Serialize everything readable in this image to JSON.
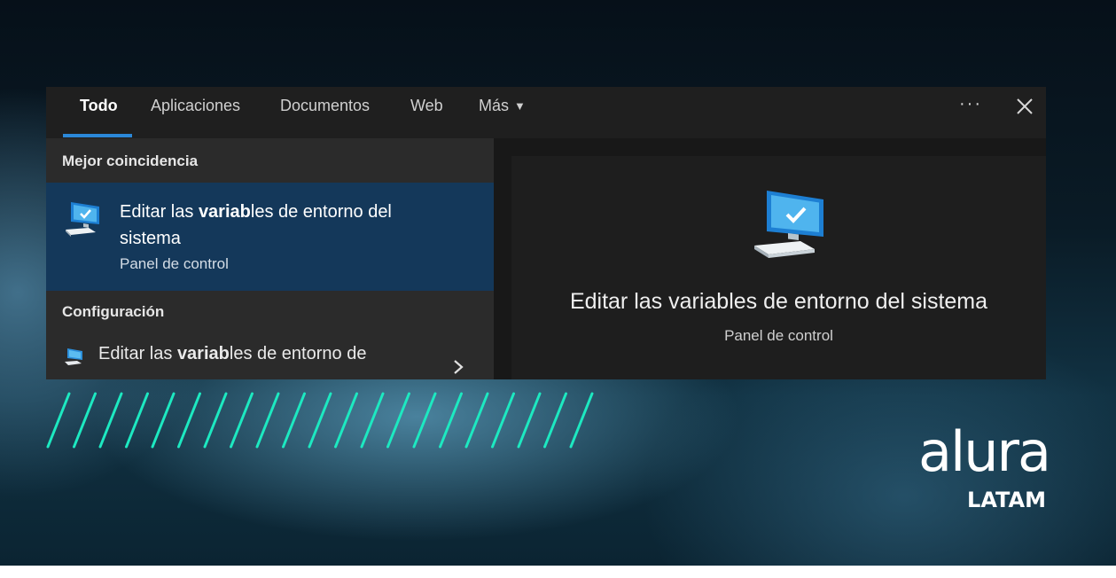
{
  "tabs": [
    {
      "label": "Todo"
    },
    {
      "label": "Aplicaciones"
    },
    {
      "label": "Documentos"
    },
    {
      "label": "Web"
    },
    {
      "label": "Más"
    }
  ],
  "more_options_label": "···",
  "sections": {
    "best_match": "Mejor coincidencia",
    "settings": "Configuración"
  },
  "best_result": {
    "title_before": "Editar las ",
    "title_bold": "variab",
    "title_after": "les de entorno del sistema",
    "subtitle": "Panel de control"
  },
  "settings_result": {
    "title_before": "Editar las ",
    "title_bold": "variab",
    "title_after": "les de entorno de"
  },
  "preview": {
    "title": "Editar las variables de entorno del sistema",
    "subtitle": "Panel de control"
  },
  "brand": {
    "logo": "alura",
    "region": "LATAM"
  },
  "colors": {
    "accent": "#2b88d8",
    "selected": "#14385a",
    "stripes": "#1de9c1"
  },
  "icons": [
    "monitor-icon",
    "chevron-down-icon",
    "close-icon",
    "chevron-right-icon"
  ]
}
